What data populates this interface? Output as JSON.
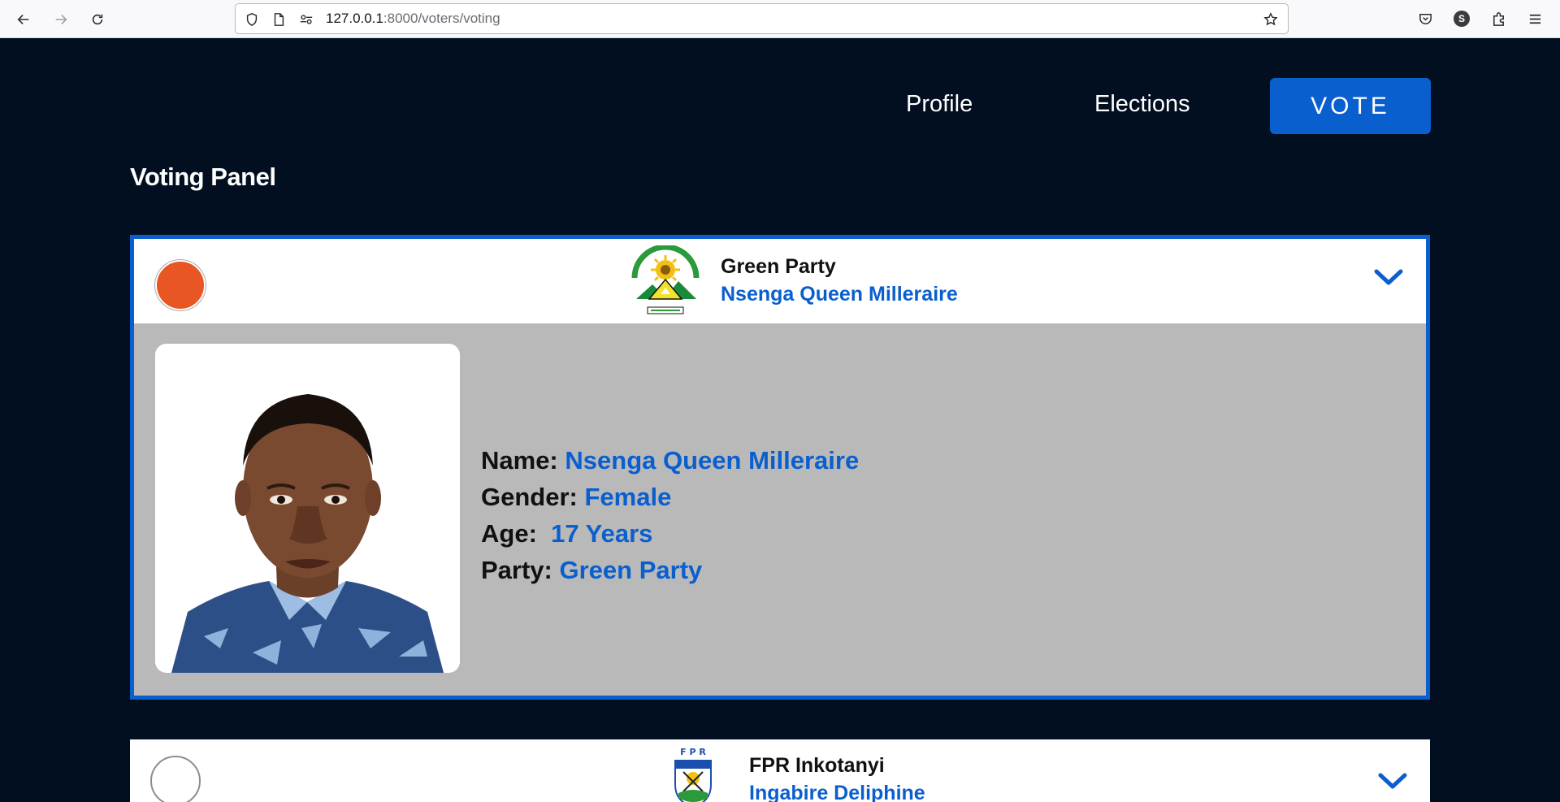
{
  "browser": {
    "url_host": "127.0.0.1",
    "url_port_path": ":8000/voters/voting",
    "profile_initial": "S",
    "icons": [
      "back-icon",
      "forward-icon",
      "reload-icon",
      "shield-icon",
      "page-icon",
      "permissions-icon",
      "bookmark-star-icon",
      "pocket-icon",
      "extensions-icon",
      "menu-icon"
    ]
  },
  "nav": {
    "profile": "Profile",
    "elections": "Elections",
    "vote": "VOTE"
  },
  "page": {
    "title": "Voting Panel"
  },
  "candidates": [
    {
      "party": "Green Party",
      "name": "Nsenga Queen Milleraire",
      "selected": true,
      "expanded": true,
      "details": {
        "name_label": "Name:",
        "name_value": "Nsenga Queen Milleraire",
        "gender_label": "Gender:",
        "gender_value": "Female",
        "age_label": "Age:",
        "age_value": "17 Years",
        "party_label": "Party:",
        "party_value": "Green Party"
      }
    },
    {
      "party": "FPR Inkotanyi",
      "name": "Ingabire Deliphine",
      "selected": false,
      "expanded": false,
      "logo_text": "F P R"
    }
  ],
  "colors": {
    "background": "#010f21",
    "accent": "#0a5fcf",
    "selected_radio": "#e85624",
    "details_bg": "#b9b9b9"
  }
}
